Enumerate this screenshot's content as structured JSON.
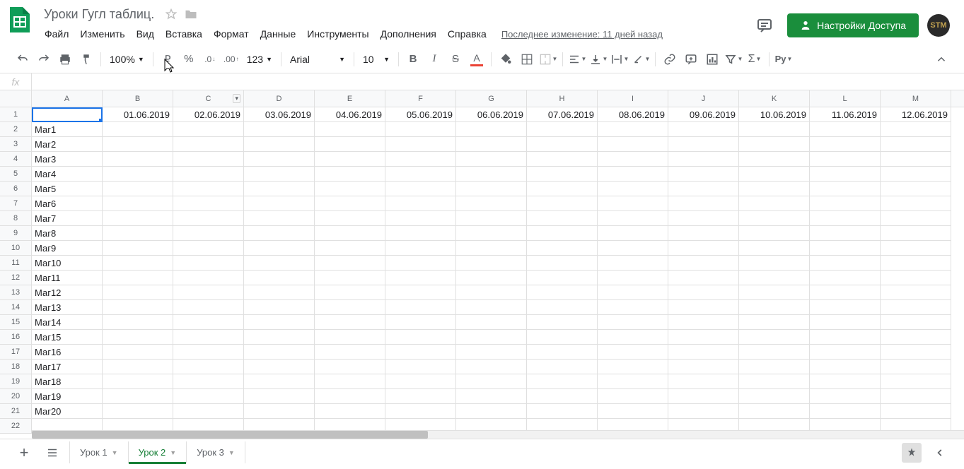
{
  "doc": {
    "title": "Уроки Гугл таблиц."
  },
  "menu": [
    "Файл",
    "Изменить",
    "Вид",
    "Вставка",
    "Формат",
    "Данные",
    "Инструменты",
    "Дополнения",
    "Справка"
  ],
  "last_edit": "Последнее изменение: 11 дней назад",
  "share_label": "Настройки Доступа",
  "avatar": "STM",
  "toolbar": {
    "zoom": "100%",
    "font": "Arial",
    "size": "10",
    "format": "123",
    "decrease_dec": ".0",
    "increase_dec": ".00",
    "percent": "%",
    "ruble": "₽"
  },
  "columns": [
    "A",
    "B",
    "C",
    "D",
    "E",
    "F",
    "G",
    "H",
    "I",
    "J",
    "K",
    "L",
    "M"
  ],
  "row_numbers": [
    1,
    2,
    3,
    4,
    5,
    6,
    7,
    8,
    9,
    10,
    11,
    12,
    13,
    14,
    15,
    16,
    17,
    18,
    19,
    20,
    21,
    22
  ],
  "header_row": [
    "",
    "01.06.2019",
    "02.06.2019",
    "03.06.2019",
    "04.06.2019",
    "05.06.2019",
    "06.06.2019",
    "07.06.2019",
    "08.06.2019",
    "09.06.2019",
    "10.06.2019",
    "11.06.2019",
    "12.06.2019"
  ],
  "col_a": [
    "",
    "Маг1",
    "Маг2",
    "Маг3",
    "Маг4",
    "Маг5",
    "Маг6",
    "Маг7",
    "Маг8",
    "Маг9",
    "Маг10",
    "Маг11",
    "Маг12",
    "Маг13",
    "Маг14",
    "Маг15",
    "Маг16",
    "Маг17",
    "Маг18",
    "Маг19",
    "Маг20",
    ""
  ],
  "sheets": [
    {
      "name": "Урок 1",
      "active": false
    },
    {
      "name": "Урок 2",
      "active": true
    },
    {
      "name": "Урок 3",
      "active": false
    }
  ]
}
